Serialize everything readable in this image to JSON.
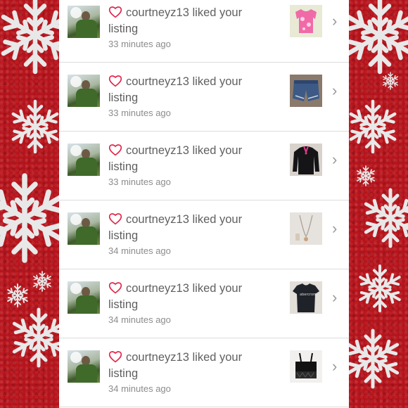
{
  "notifications": [
    {
      "username": "courtneyz13",
      "message": "liked your",
      "message2": "listing",
      "time": "33 minutes ago",
      "thumb": "pink-top"
    },
    {
      "username": "courtneyz13",
      "message": "liked your",
      "message2": "listing",
      "time": "33 minutes ago",
      "thumb": "denim-shorts"
    },
    {
      "username": "courtneyz13",
      "message": "liked your",
      "message2": "listing",
      "time": "33 minutes ago",
      "thumb": "black-sweater"
    },
    {
      "username": "courtneyz13",
      "message": "liked your",
      "message2": "listing",
      "time": "34 minutes ago",
      "thumb": "necklace"
    },
    {
      "username": "courtneyz13",
      "message": "liked your",
      "message2": "listing",
      "time": "34 minutes ago",
      "thumb": "black-tshirt"
    },
    {
      "username": "courtneyz13",
      "message": "liked your",
      "message2": "listing",
      "time": "34 minutes ago",
      "thumb": "black-bra-top"
    }
  ],
  "colors": {
    "background": "#b3141c",
    "heart": "#e0264a",
    "text": "#606060",
    "time": "#8c8c8c"
  },
  "icons": {
    "heart": "heart-outline-icon",
    "chevron": "chevron-right-icon"
  }
}
